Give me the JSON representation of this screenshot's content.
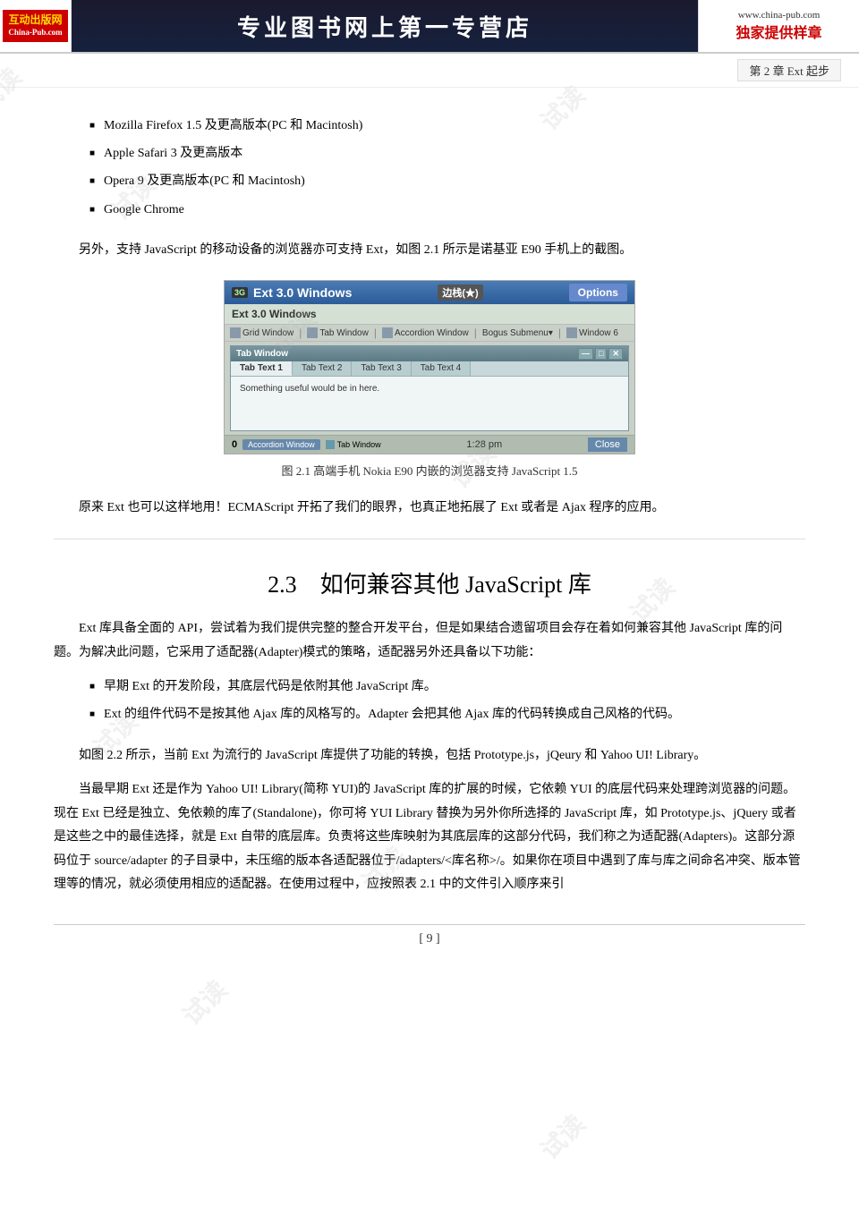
{
  "header": {
    "logo_top": "互动出版网",
    "logo_sub": "China-Pub.com",
    "title": "专业图书网上第一专营店",
    "url": "www.china-pub.com",
    "slogan": "独家提供样章"
  },
  "chapter_bar": {
    "text": "第 2 章   Ext 起步"
  },
  "bullet_items": [
    "Mozilla Firefox 1.5 及更高版本(PC 和 Macintosh)",
    "Apple Safari 3 及更高版本",
    "Opera 9 及更高版本(PC 和 Macintosh)",
    "Google Chrome"
  ],
  "paragraph1": "另外，支持 JavaScript 的移动设备的浏览器亦可支持 Ext，如图 2.1 所示是诺基亚 E90 手机上的截图。",
  "screenshot": {
    "titlebar": {
      "badge": "3G",
      "title": "Ext 3.0 Windows",
      "signal": "边栈(★)",
      "options": "Options"
    },
    "ext_bar": "Ext 3.0 Windows",
    "menu_items": [
      "Grid Window",
      "Tab Window",
      "Accordion Window",
      "Bogus Submenu▾",
      "Window 6"
    ],
    "tabwin": {
      "title": "Tab Window",
      "controls": [
        "—",
        "□",
        "✕"
      ],
      "tabs": [
        "Tab Text 1",
        "Tab Text 2",
        "Tab Text 3",
        "Tab Text 4"
      ],
      "active_tab": 0,
      "content": "Something useful would be in here."
    },
    "bottom": {
      "accordion": "Accordion Window",
      "tabwin": "Tab Window",
      "zero": "0",
      "time": "1:28 pm",
      "close": "Close"
    }
  },
  "figure_caption": "图 2.1    高端手机 Nokia E90 内嵌的浏览器支持 JavaScript 1.5",
  "paragraph2": "原来 Ext 也可以这样地用！ECMAScript 开拓了我们的眼界，也真正地拓展了 Ext 或者是 Ajax 程序的应用。",
  "section": {
    "num": "2.3",
    "title": "如何兼容其他 JavaScript 库"
  },
  "paragraph3": "Ext 库具备全面的 API，尝试着为我们提供完整的整合开发平台，但是如果结合遗留项目会存在着如何兼容其他 JavaScript 库的问题。为解决此问题，它采用了适配器(Adapter)模式的策略，适配器另外还具备以下功能：",
  "bullet2_items": [
    "早期 Ext 的开发阶段，其底层代码是依附其他 JavaScript 库。",
    "Ext 的组件代码不是按其他 Ajax 库的风格写的。Adapter 会把其他 Ajax 库的代码转换成自己风格的代码。"
  ],
  "paragraph4": "如图 2.2 所示，当前 Ext 为流行的 JavaScript 库提供了功能的转换，包括 Prototype.js，jQeury 和 Yahoo UI! Library。",
  "paragraph5": "当最早期 Ext 还是作为 Yahoo UI! Library(简称 YUI)的 JavaScript 库的扩展的时候，它依赖 YUI 的底层代码来处理跨浏览器的问题。现在 Ext 已经是独立、免依赖的库了(Standalone)，你可将 YUI Library 替换为另外你所选择的 JavaScript 库，如 Prototype.js、jQuery 或者是这些之中的最佳选择，就是 Ext 自带的底层库。负责将这些库映射为其底层库的这部分代码，我们称之为适配器(Adapters)。这部分源码位于 source/adapter 的子目录中，未压缩的版本各适配器位于/adapters/<库名称>/。如果你在项目中遇到了库与库之间命名冲突、版本管理等的情况，就必须使用相应的适配器。在使用过程中，应按照表 2.1 中的文件引入顺序来引",
  "page_number": "[ 9 ]",
  "watermark_text": "试读"
}
